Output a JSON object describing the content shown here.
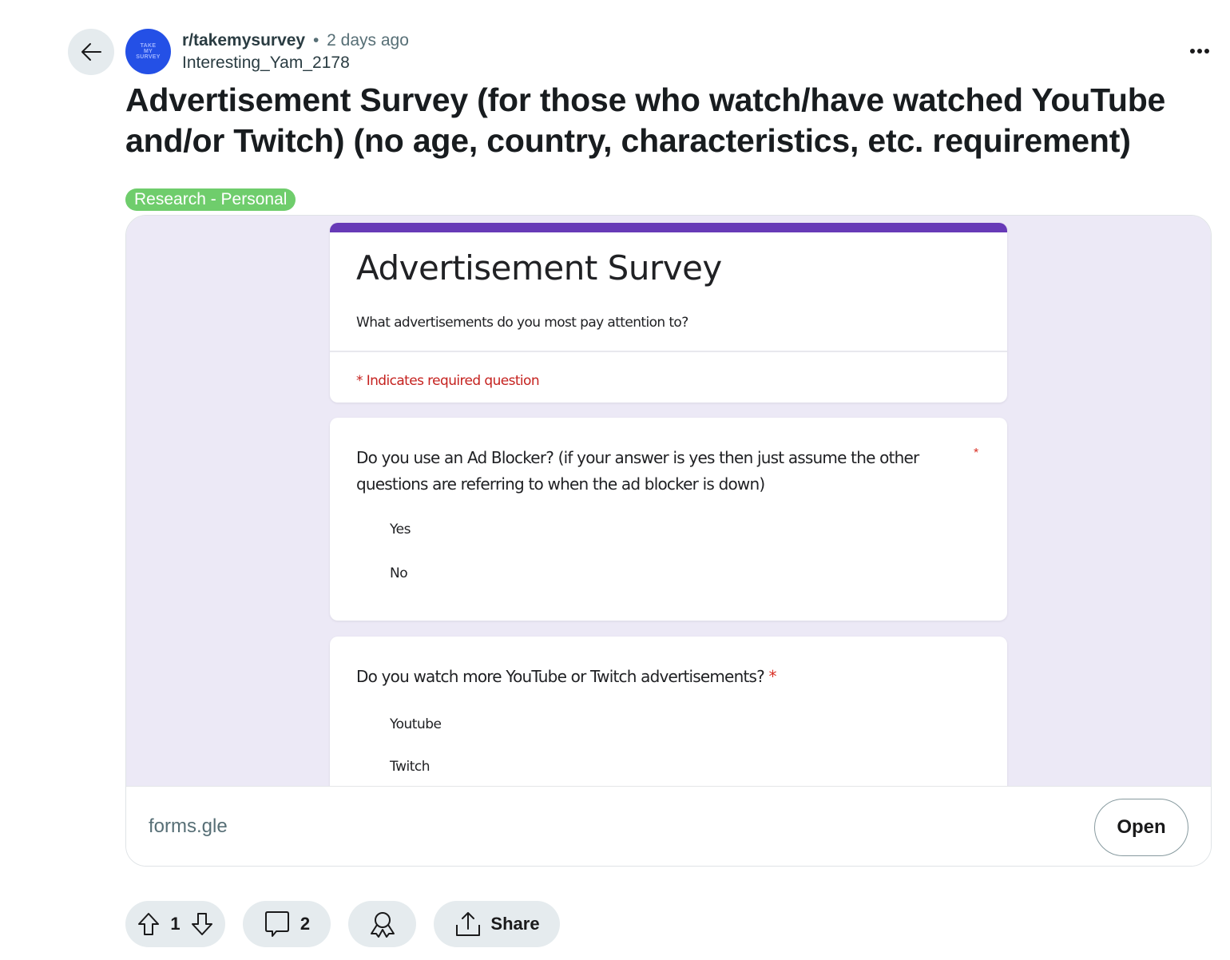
{
  "post": {
    "subreddit": "r/takemysurvey",
    "separator": "•",
    "time_ago": "2 days ago",
    "author": "Interesting_Yam_2178",
    "avatar_text": [
      "TAKE",
      "MY",
      "SURVEY"
    ],
    "title": "Advertisement Survey (for those who watch/have watched YouTube and/or Twitch) (no age, country, characteristics, etc. requirement)",
    "flair": "Research - Personal",
    "flair_color": "#6fcd6c"
  },
  "link_preview": {
    "form": {
      "accent_color": "#673ab7",
      "title": "Advertisement Survey",
      "description": "What advertisements do you most pay attention to?",
      "required_note": "* Indicates required question",
      "questions": [
        {
          "text": "Do you use an Ad Blocker? (if your answer is yes then just assume the other questions are referring to when the ad blocker is down)",
          "required_marker": "*",
          "options": [
            "Yes",
            "No"
          ]
        },
        {
          "text": "Do you watch more YouTube or Twitch advertisements?",
          "required_marker": "*",
          "options": [
            "Youtube",
            "Twitch"
          ]
        }
      ]
    },
    "domain": "forms.gle",
    "open_label": "Open"
  },
  "actions": {
    "vote_count": "1",
    "comment_count": "2",
    "share_label": "Share"
  },
  "icons": {
    "back": "arrow-left-icon",
    "more": "ellipsis-icon",
    "upvote": "arrow-up-outline-icon",
    "downvote": "arrow-down-outline-icon",
    "comment": "speech-bubble-icon",
    "award": "award-ribbon-icon",
    "share": "share-upload-icon"
  }
}
